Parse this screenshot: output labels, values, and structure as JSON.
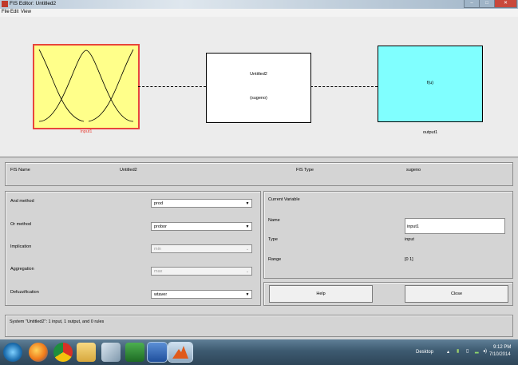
{
  "window": {
    "title": "FIS Editor: Untitled2"
  },
  "menu": [
    "File",
    "Edit",
    "View"
  ],
  "diagram": {
    "input_label": "input1",
    "system_name": "Untitled2",
    "system_type": "(sugeno)",
    "output_block_text": "f(u)",
    "output_label": "output1",
    "colors": {
      "input": "#ffff8a",
      "input_border": "#e8453c",
      "output": "#80ffff"
    }
  },
  "fis": {
    "name_label": "FIS Name",
    "name_value": "Untitled2",
    "type_label": "FIS Type",
    "type_value": "sugeno"
  },
  "methods": {
    "and_label": "And method",
    "and_value": "prod",
    "or_label": "Or method",
    "or_value": "probor",
    "implication_label": "Implication",
    "implication_value": "min",
    "aggregation_label": "Aggregation",
    "aggregation_value": "max",
    "defuzz_label": "Defuzzification",
    "defuzz_value": "wtaver"
  },
  "current_variable": {
    "header": "Current Variable",
    "name_label": "Name",
    "name_value": "input1",
    "type_label": "Type",
    "type_value": "input",
    "range_label": "Range",
    "range_value": "[0 1]"
  },
  "buttons": {
    "help": "Help",
    "close": "Close"
  },
  "status": "System \"Untitled2\": 1 input, 1 output, and 0 rules",
  "taskbar": {
    "desktop_label": "Desktop",
    "time": "9:12 PM",
    "date": "7/10/2014",
    "icons": [
      "start-orb-icon",
      "firefox-icon",
      "chrome-icon",
      "file-explorer-icon",
      "pen-tool-icon",
      "excel-icon",
      "word-icon",
      "matlab-icon"
    ]
  }
}
